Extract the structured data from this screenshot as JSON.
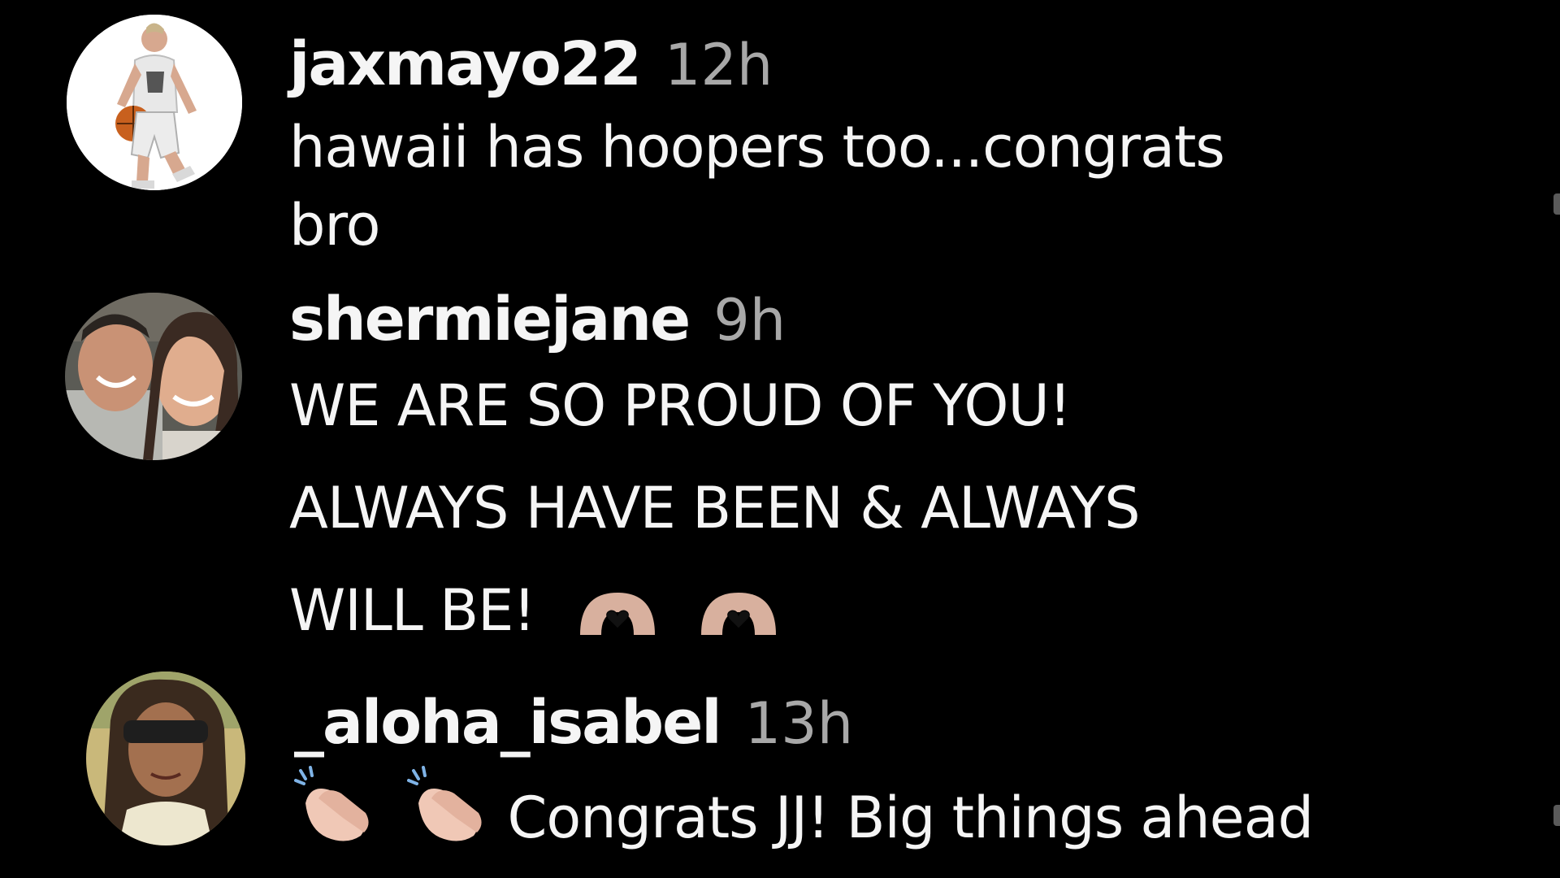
{
  "comments": [
    {
      "username": "jaxmayo22",
      "time": "12h",
      "text_lines": [
        "hawaii has hoopers too...congrats",
        "bro"
      ],
      "avatar_icon": "basketball-player-photo"
    },
    {
      "username": "shermiejane",
      "time": "9h",
      "text_lines": [
        "WE ARE SO PROUD OF YOU!",
        "ALWAYS HAVE BEEN & ALWAYS",
        "WILL BE!"
      ],
      "emojis": [
        "heart-hands-icon",
        "heart-hands-icon"
      ],
      "avatar_icon": "couple-selfie-photo"
    },
    {
      "username": "_aloha_isabel",
      "time": "13h",
      "emojis": [
        "clapping-hands-icon",
        "clapping-hands-icon"
      ],
      "text": "Congrats JJ! Big things ahead",
      "avatar_icon": "woman-sunglasses-photo"
    }
  ],
  "colors": {
    "background": "#000000",
    "text": "#f5f5f5",
    "timestamp": "#a8a8a8",
    "emoji_skin": "#e9c2b0"
  }
}
